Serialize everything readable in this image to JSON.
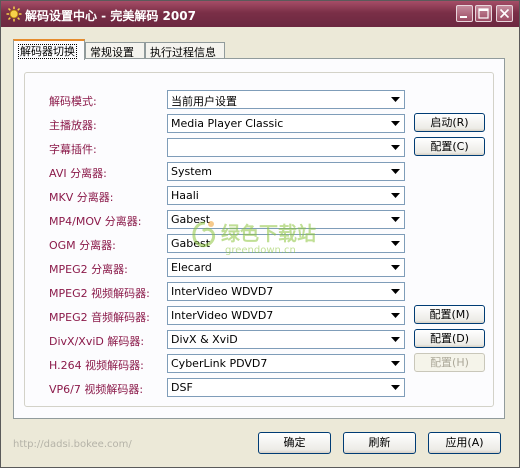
{
  "window": {
    "title": "解码设置中心 - 完美解码 2007"
  },
  "tabs": [
    {
      "label": "解码器切换",
      "active": true
    },
    {
      "label": "常规设置",
      "active": false
    },
    {
      "label": "执行过程信息",
      "active": false
    }
  ],
  "rows": [
    {
      "label": "解码模式:",
      "value": "当前用户设置"
    },
    {
      "label": "主播放器:",
      "value": "Media Player Classic"
    },
    {
      "label": "字幕插件:",
      "value": ""
    },
    {
      "label": "AVI 分离器:",
      "value": "System"
    },
    {
      "label": "MKV 分离器:",
      "value": "Haali"
    },
    {
      "label": "MP4/MOV 分离器:",
      "value": "Gabest"
    },
    {
      "label": "OGM 分离器:",
      "value": "Gabest"
    },
    {
      "label": "MPEG2 分离器:",
      "value": "Elecard"
    },
    {
      "label": "MPEG2 视频解码器:",
      "value": "InterVideo WDVD7"
    },
    {
      "label": "MPEG2 音频解码器:",
      "value": "InterVideo WDVD7"
    },
    {
      "label": "DivX/XviD 解码器:",
      "value": "DivX & XviD"
    },
    {
      "label": "H.264 视频解码器:",
      "value": "CyberLink PDVD7"
    },
    {
      "label": "VP6/7 视频解码器:",
      "value": "DSF"
    }
  ],
  "side_buttons": {
    "start": "启动(R)",
    "config_c": "配置(C)",
    "config_m": "配置(M)",
    "config_d": "配置(D)",
    "config_h": "配置(H)"
  },
  "bottom": {
    "url": "http://dadsi.bokee.com/",
    "ok": "确定",
    "refresh": "刷新",
    "apply": "应用(A)"
  },
  "watermark": {
    "title": "绿色下载站",
    "subtitle": "greendown.cn"
  },
  "colors": {
    "titlebar": "#7a2f47",
    "label": "#8b1a4a",
    "tab_accent": "#e68b2c"
  }
}
